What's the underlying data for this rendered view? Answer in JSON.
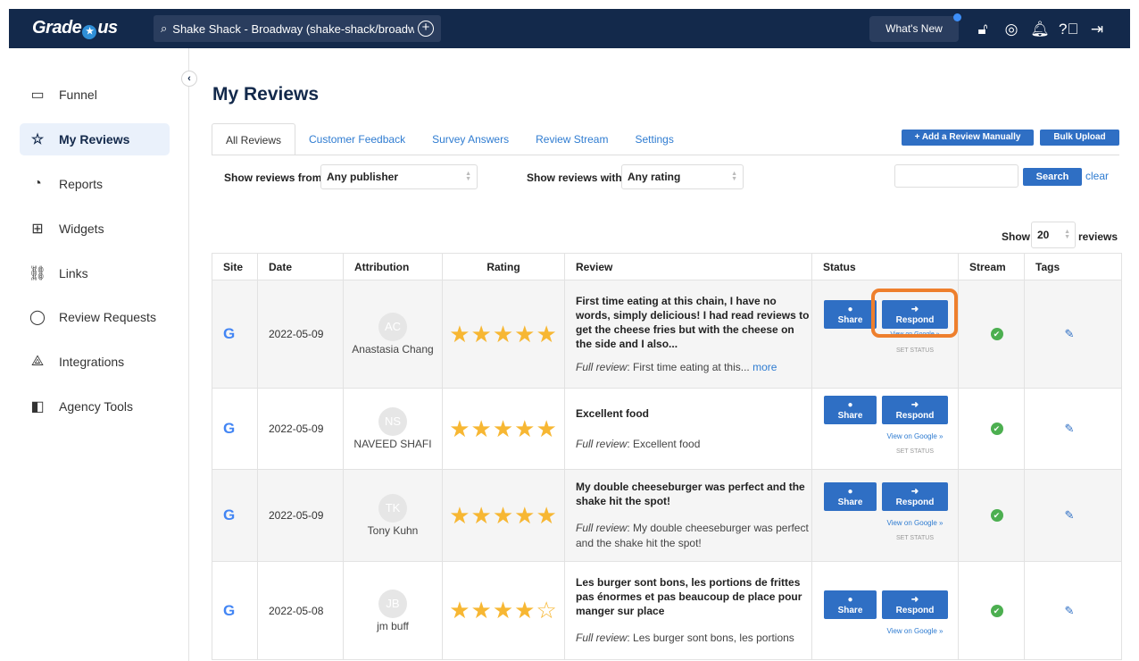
{
  "app": {
    "logo_left": "Grade",
    "logo_right": "us",
    "business": "Shake Shack - Broadway (shake-shack/broadway)",
    "whats_new": "What's New"
  },
  "sidebar": {
    "items": [
      {
        "label": "Funnel",
        "icon": "funnel-icon"
      },
      {
        "label": "My Reviews",
        "icon": "star-outline-icon"
      },
      {
        "label": "Reports",
        "icon": "pie-chart-icon"
      },
      {
        "label": "Widgets",
        "icon": "widgets-grid-icon"
      },
      {
        "label": "Links",
        "icon": "link-icon"
      },
      {
        "label": "Review Requests",
        "icon": "chat-bubble-icon"
      },
      {
        "label": "Integrations",
        "icon": "integrations-icon"
      },
      {
        "label": "Agency Tools",
        "icon": "briefcase-icon"
      }
    ]
  },
  "main": {
    "title": "My Reviews",
    "tabs": [
      "All Reviews",
      "Customer Feedback",
      "Survey Answers",
      "Review Stream",
      "Settings"
    ],
    "add_manual": "+ Add a Review Manually",
    "bulk_upload": "Bulk Upload",
    "filter_from_label": "Show reviews from",
    "filter_from_value": "Any publisher",
    "filter_with_label": "Show reviews with",
    "filter_with_value": "Any rating",
    "search_label": "Search",
    "clear_label": "clear",
    "show_label": "Show",
    "show_value": "20",
    "reviews_label": "reviews"
  },
  "table": {
    "headers": [
      "Site",
      "Date",
      "Attribution",
      "Rating",
      "Review",
      "Status",
      "Stream",
      "Tags"
    ],
    "share_label": "Share",
    "respond_label": "Respond",
    "view_google": "View on Google »",
    "set_status": "SET STATUS",
    "full_review_label": "Full review",
    "more_label": "more",
    "rows": [
      {
        "site": "G",
        "date": "2022-05-09",
        "initials": "AC",
        "name": "Anastasia Chang",
        "rating": 5,
        "title": "First time eating at this chain, I have no words, simply delicious! I had read reviews to get the cheese fries but with the cheese on the side and I also...",
        "full": ": First time eating at this...",
        "has_more": true
      },
      {
        "site": "G",
        "date": "2022-05-09",
        "initials": "NS",
        "name": "NAVEED SHAFI",
        "rating": 5,
        "title": "Excellent food",
        "full": ": Excellent food",
        "has_more": false
      },
      {
        "site": "G",
        "date": "2022-05-09",
        "initials": "TK",
        "name": "Tony Kuhn",
        "rating": 5,
        "title": "My double cheeseburger was perfect and the shake hit the spot!",
        "full": ": My double cheeseburger was perfect and the shake hit the spot!",
        "has_more": false
      },
      {
        "site": "G",
        "date": "2022-05-08",
        "initials": "JB",
        "name": "jm buff",
        "rating": 4,
        "title": "Les burger sont bons, les portions de frittes pas énormes et pas beaucoup de place pour manger sur place",
        "full": ": Les burger sont bons, les portions",
        "has_more": false
      }
    ]
  },
  "colors": {
    "topbar": "#13294b",
    "accent": "#2f6fc4",
    "highlight": "#ee7f2d",
    "star": "#f7b733",
    "stream_ok": "#4caf50"
  }
}
